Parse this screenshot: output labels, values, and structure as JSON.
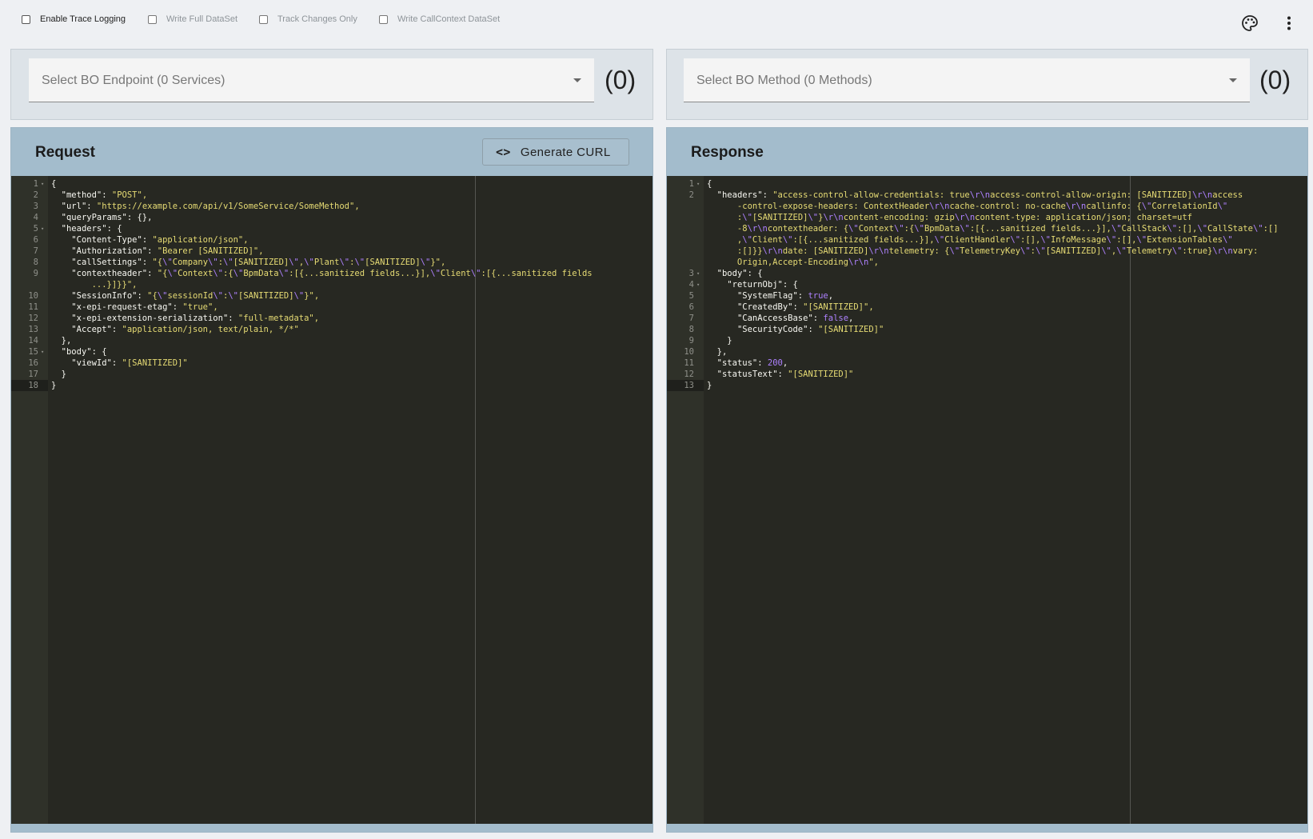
{
  "options": [
    {
      "label": "Enable Trace Logging",
      "checked": false,
      "active": true
    },
    {
      "label": "Write Full DataSet",
      "checked": false,
      "active": false
    },
    {
      "label": "Track Changes Only",
      "checked": false,
      "active": false
    },
    {
      "label": "Write CallContext DataSet",
      "checked": false,
      "active": false
    }
  ],
  "icons": {
    "theme": "palette-icon",
    "menu": "more-vert-icon"
  },
  "endpoint": {
    "placeholder": "Select BO Endpoint (0 Services)",
    "count": "(0)"
  },
  "method": {
    "placeholder": "Select BO Method (0 Methods)",
    "count": "(0)"
  },
  "request": {
    "title": "Request",
    "curl_label": "Generate CURL",
    "curl_icon": "<>",
    "lines": [
      {
        "n": "1",
        "fold": true,
        "text": "{"
      },
      {
        "n": "2",
        "text": "  \"method\": \"POST\","
      },
      {
        "n": "3",
        "text": "  \"url\": \"https://example.com/api/v1/SomeService/SomeMethod\","
      },
      {
        "n": "4",
        "text": "  \"queryParams\": {},"
      },
      {
        "n": "5",
        "fold": true,
        "text": "  \"headers\": {"
      },
      {
        "n": "6",
        "text": "    \"Content-Type\": \"application/json\","
      },
      {
        "n": "7",
        "text": "    \"Authorization\": \"Bearer [SANITIZED]\","
      },
      {
        "n": "8",
        "text": "    \"callSettings\": \"{\\\"Company\\\":\\\"[SANITIZED]\\\",\\\"Plant\\\":\\\"[SANITIZED]\\\"}\","
      },
      {
        "n": "9",
        "text": "    \"contextheader\": \"{\\\"Context\\\":{\\\"BpmData\\\":[{...sanitized fields...}],\\\"Client\\\":[{...sanitized fields"
      },
      {
        "n": "",
        "text": "        ...}]}}\","
      },
      {
        "n": "10",
        "text": "    \"SessionInfo\": \"{\\\"sessionId\\\":\\\"[SANITIZED]\\\"}\","
      },
      {
        "n": "11",
        "text": "    \"x-epi-request-etag\": \"true\","
      },
      {
        "n": "12",
        "text": "    \"x-epi-extension-serialization\": \"full-metadata\","
      },
      {
        "n": "13",
        "text": "    \"Accept\": \"application/json, text/plain, */*\""
      },
      {
        "n": "14",
        "text": "  },"
      },
      {
        "n": "15",
        "fold": true,
        "text": "  \"body\": {"
      },
      {
        "n": "16",
        "text": "    \"viewId\": \"[SANITIZED]\""
      },
      {
        "n": "17",
        "text": "  }"
      },
      {
        "n": "18",
        "text": "}",
        "active": true
      }
    ]
  },
  "response": {
    "title": "Response",
    "lines": [
      {
        "n": "1",
        "fold": true,
        "text": "{"
      },
      {
        "n": "2",
        "text": "  \"headers\": \"access-control-allow-credentials: true\\r\\naccess-control-allow-origin: [SANITIZED]\\r\\naccess"
      },
      {
        "n": "",
        "text": "      -control-expose-headers: ContextHeader\\r\\ncache-control: no-cache\\r\\ncallinfo: {\\\"CorrelationId\\\""
      },
      {
        "n": "",
        "text": "      :\\\"[SANITIZED]\\\"}\\r\\ncontent-encoding: gzip\\r\\ncontent-type: application/json; charset=utf"
      },
      {
        "n": "",
        "text": "      -8\\r\\ncontextheader: {\\\"Context\\\":{\\\"BpmData\\\":[{...sanitized fields...}],\\\"CallStack\\\":[],\\\"CallState\\\":[]"
      },
      {
        "n": "",
        "text": "      ,\\\"Client\\\":[{...sanitized fields...}],\\\"ClientHandler\\\":[],\\\"InfoMessage\\\":[],\\\"ExtensionTables\\\""
      },
      {
        "n": "",
        "text": "      :[]}}\\r\\ndate: [SANITIZED]\\r\\ntelemetry: {\\\"TelemetryKey\\\":\\\"[SANITIZED]\\\",\\\"Telemetry\\\":true}\\r\\nvary:"
      },
      {
        "n": "",
        "text": "      Origin,Accept-Encoding\\r\\n\","
      },
      {
        "n": "3",
        "fold": true,
        "text": "  \"body\": {"
      },
      {
        "n": "4",
        "fold": true,
        "text": "    \"returnObj\": {"
      },
      {
        "n": "5",
        "text": "      \"SystemFlag\": true,"
      },
      {
        "n": "6",
        "text": "      \"CreatedBy\": \"[SANITIZED]\","
      },
      {
        "n": "7",
        "text": "      \"CanAccessBase\": false,"
      },
      {
        "n": "8",
        "text": "      \"SecurityCode\": \"[SANITIZED]\""
      },
      {
        "n": "9",
        "text": "    }"
      },
      {
        "n": "10",
        "text": "  },"
      },
      {
        "n": "11",
        "text": "  \"status\": 200,"
      },
      {
        "n": "12",
        "text": "  \"statusText\": \"[SANITIZED]\""
      },
      {
        "n": "13",
        "text": "}",
        "active": true
      }
    ]
  }
}
